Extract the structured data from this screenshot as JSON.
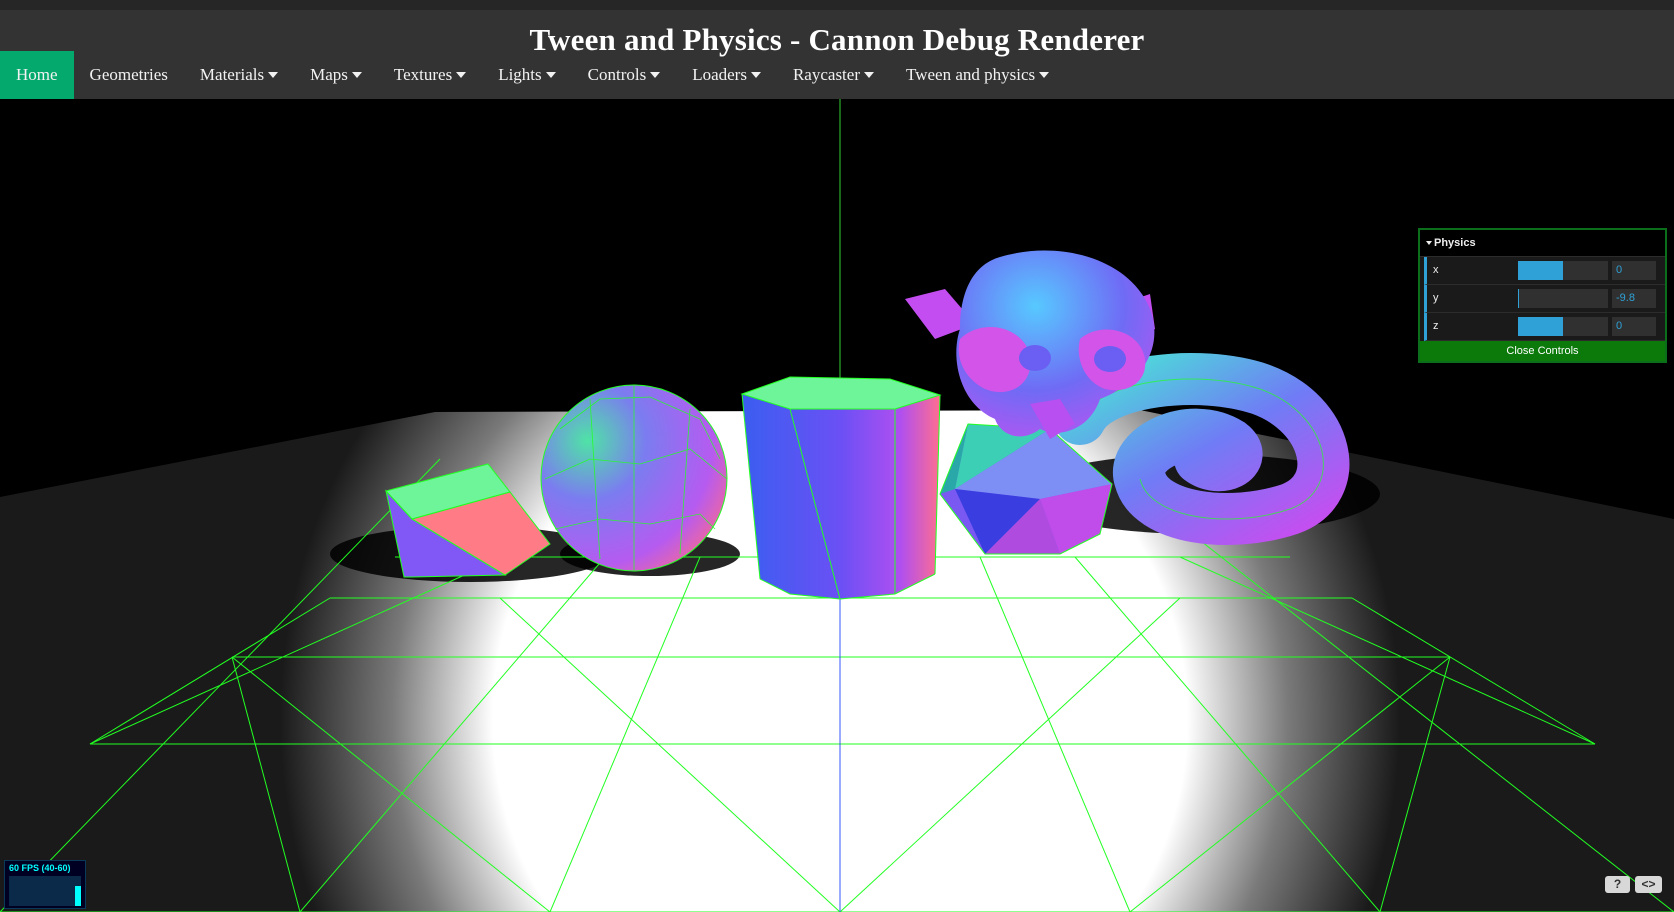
{
  "header": {
    "title": "Tween and Physics - Cannon Debug Renderer"
  },
  "nav": [
    {
      "label": "Home",
      "active": true,
      "dropdown": false
    },
    {
      "label": "Geometries",
      "dropdown": false
    },
    {
      "label": "Materials",
      "dropdown": true
    },
    {
      "label": "Maps",
      "dropdown": true
    },
    {
      "label": "Textures",
      "dropdown": true
    },
    {
      "label": "Lights",
      "dropdown": true
    },
    {
      "label": "Controls",
      "dropdown": true
    },
    {
      "label": "Loaders",
      "dropdown": true
    },
    {
      "label": "Raycaster",
      "dropdown": true
    },
    {
      "label": "Tween and physics",
      "dropdown": true
    }
  ],
  "gui": {
    "folder": "Physics",
    "controls": [
      {
        "label": "x",
        "value": "0",
        "fill": 0.5
      },
      {
        "label": "y",
        "value": "-9.8",
        "fill": 0.0
      },
      {
        "label": "z",
        "value": "0",
        "fill": 0.5
      }
    ],
    "close_label": "Close Controls"
  },
  "stats": {
    "text": "60 FPS (40-60)"
  },
  "corner_buttons": {
    "help": "?",
    "source": "<>"
  },
  "colors": {
    "nav_active": "#04AA6D",
    "wireframe": "#00ff00",
    "gui_accent": "#2fa1d6"
  }
}
